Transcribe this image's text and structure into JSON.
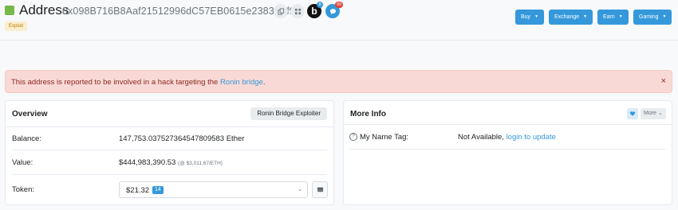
{
  "header": {
    "title_label": "Address",
    "address": "0x098B716B8Aaf21512996dC57EB0615e2383E2f96",
    "tag": "Exploit",
    "badge_b_count": "8",
    "badge_chat_count": "99",
    "nav": [
      {
        "label": "Buy"
      },
      {
        "label": "Exchange"
      },
      {
        "label": "Earn"
      },
      {
        "label": "Gaming"
      }
    ]
  },
  "alert": {
    "text_before": "This address is reported to be involved in a hack targeting the ",
    "link": "Ronin bridge",
    "text_after": ".",
    "close": "×"
  },
  "overview": {
    "title": "Overview",
    "tag_button": "Ronin Bridge Exploiter",
    "balance_label": "Balance:",
    "balance_value": "147,753.037527364547809583 Ether",
    "value_label": "Value:",
    "value_amount": "$444,983,390.53",
    "value_rate": "(@ $3,011.67/ETH)",
    "token_label": "Token:",
    "token_value": "$21.32",
    "token_count": "14"
  },
  "more_info": {
    "title": "More Info",
    "more_button": "More",
    "name_tag_label": "My Name Tag:",
    "name_tag_value": "Not Available, ",
    "name_tag_link": "login to update"
  },
  "colors": {
    "accent": "#3498db",
    "alert_bg": "#f9d9d6",
    "brand_green": "#77b84a"
  }
}
